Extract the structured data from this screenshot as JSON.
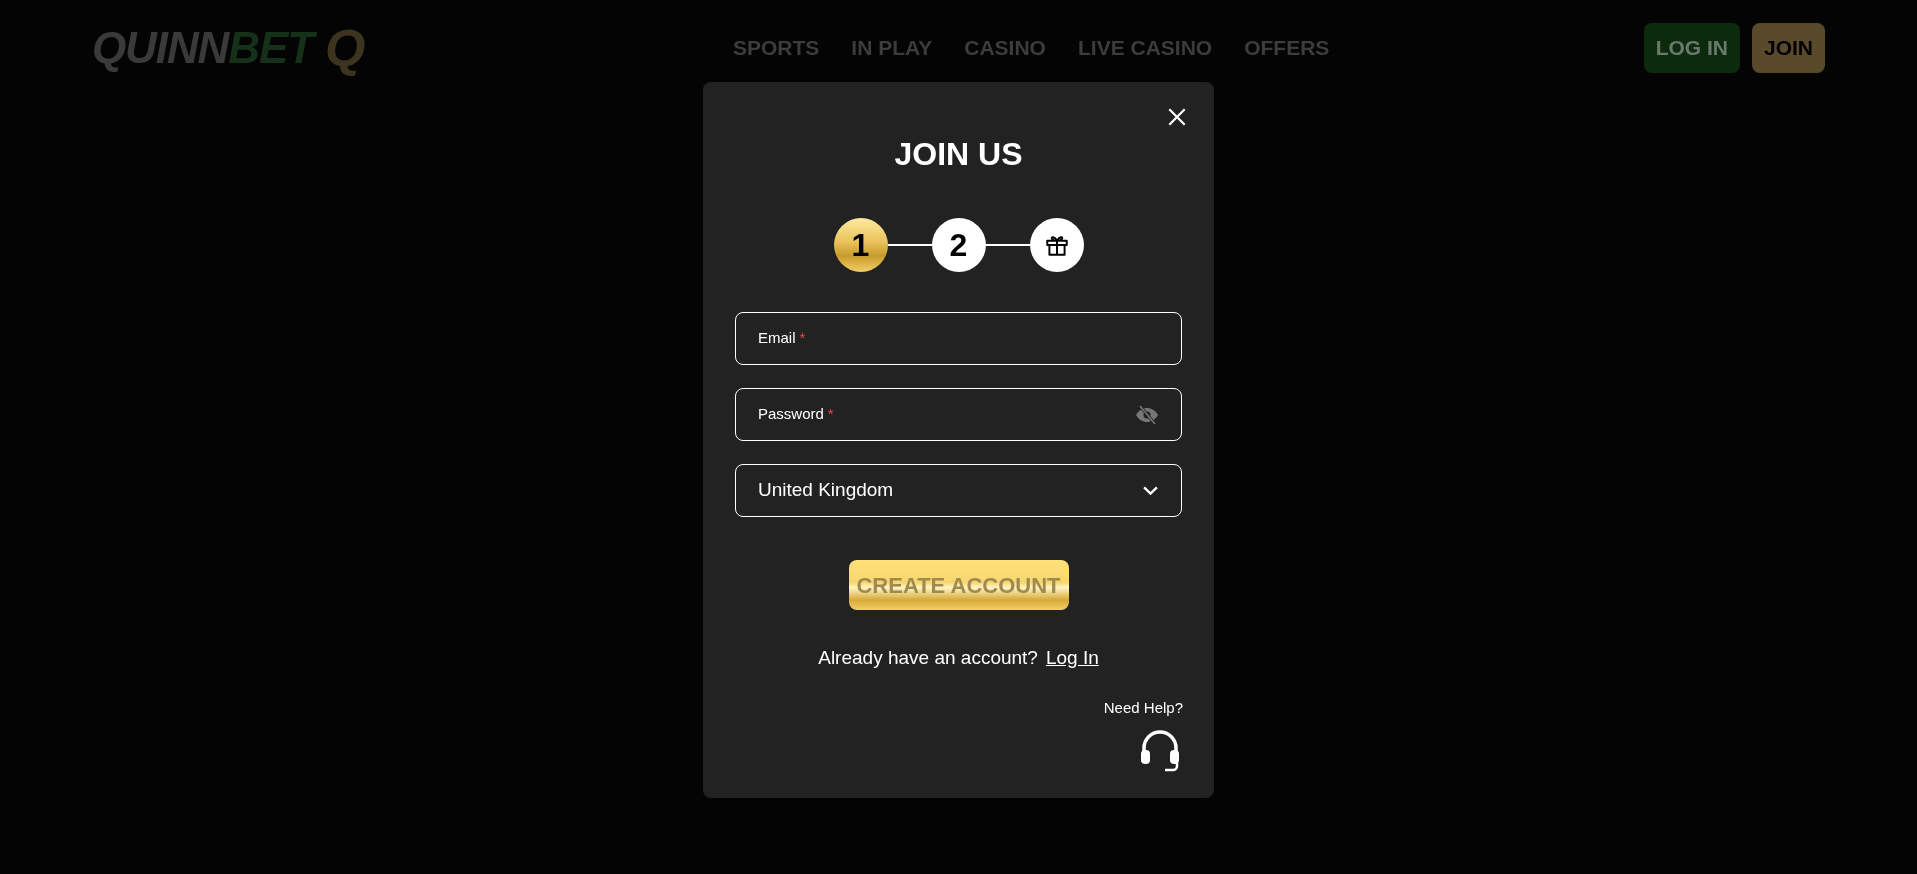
{
  "header": {
    "logo": {
      "parts": [
        "QUINN",
        "BET"
      ],
      "mark": "Q"
    },
    "nav": [
      "SPORTS",
      "IN PLAY",
      "CASINO",
      "LIVE CASINO",
      "OFFERS"
    ],
    "buttons": [
      {
        "kind": "login",
        "label": "LOG IN"
      },
      {
        "kind": "join",
        "label": "JOIN"
      }
    ]
  },
  "dialog": {
    "title": "JOIN US",
    "steps": [
      {
        "kind": "number",
        "label": "1",
        "selected": true
      },
      {
        "kind": "number",
        "label": "2",
        "selected": false
      },
      {
        "kind": "gift",
        "selected": false
      }
    ],
    "fields": [
      {
        "kind": "text",
        "label": "Email",
        "required_mark": "*"
      },
      {
        "kind": "password",
        "label": "Password",
        "required_mark": "*"
      },
      {
        "kind": "select",
        "value": "United Kingdom"
      }
    ],
    "submit": {
      "label": "CREATE ACCOUNT",
      "disabled": true
    },
    "login_prompt": {
      "text": "Already have an account?",
      "link": "Log In"
    },
    "help": {
      "label": "Need Help?"
    }
  }
}
